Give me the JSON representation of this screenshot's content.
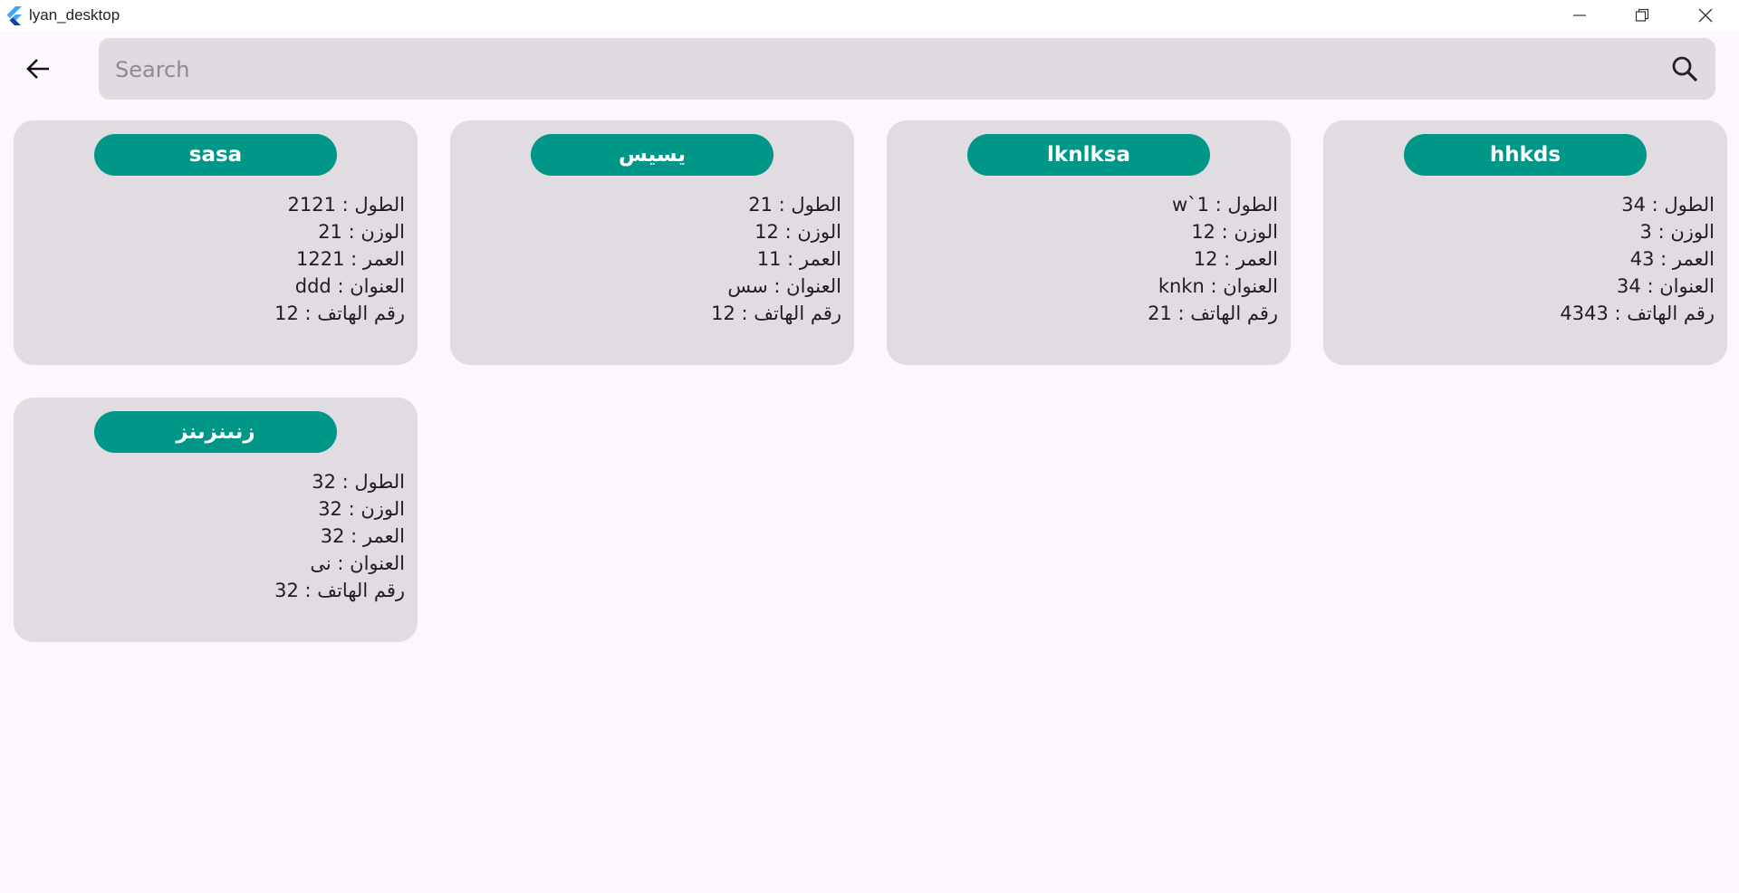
{
  "window": {
    "title": "lyan_desktop",
    "colors": {
      "accent": "#009688",
      "card_bg": "#e1dbe2",
      "page_bg": "#fdf7fd"
    }
  },
  "toolbar": {
    "back_icon": "arrow-left-icon"
  },
  "search": {
    "placeholder": "Search",
    "value": "",
    "icon": "search-icon"
  },
  "labels": {
    "height": "الطول",
    "weight": "الوزن",
    "age": "العمر",
    "address": "العنوان",
    "phone": "رقم الهاتف"
  },
  "cards": [
    {
      "name": "hhkds",
      "rows": [
        "الطول : 34",
        "الوزن : 3",
        "العمر : 43",
        "العنوان : 34",
        "رقم الهاتف : 4343"
      ]
    },
    {
      "name": "lknlksa",
      "rows": [
        "الطول : w`1",
        "الوزن : 12",
        "العمر : 12",
        "العنوان : knkn",
        "رقم الهاتف : 21"
      ]
    },
    {
      "name": "يسيس",
      "rows": [
        "الطول : 21",
        "الوزن : 12",
        "العمر : 11",
        "العنوان : سس",
        "رقم الهاتف : 12"
      ]
    },
    {
      "name": "sasa",
      "rows": [
        "الطول : 2121",
        "الوزن : 21",
        "العمر : 1221",
        "العنوان : ddd",
        "رقم الهاتف : 12"
      ]
    },
    {
      "name": "زنىنزىنز",
      "rows": [
        "الطول : 32",
        "الوزن : 32",
        "العمر : 32",
        "العنوان : نى",
        "رقم الهاتف : 32"
      ]
    }
  ]
}
